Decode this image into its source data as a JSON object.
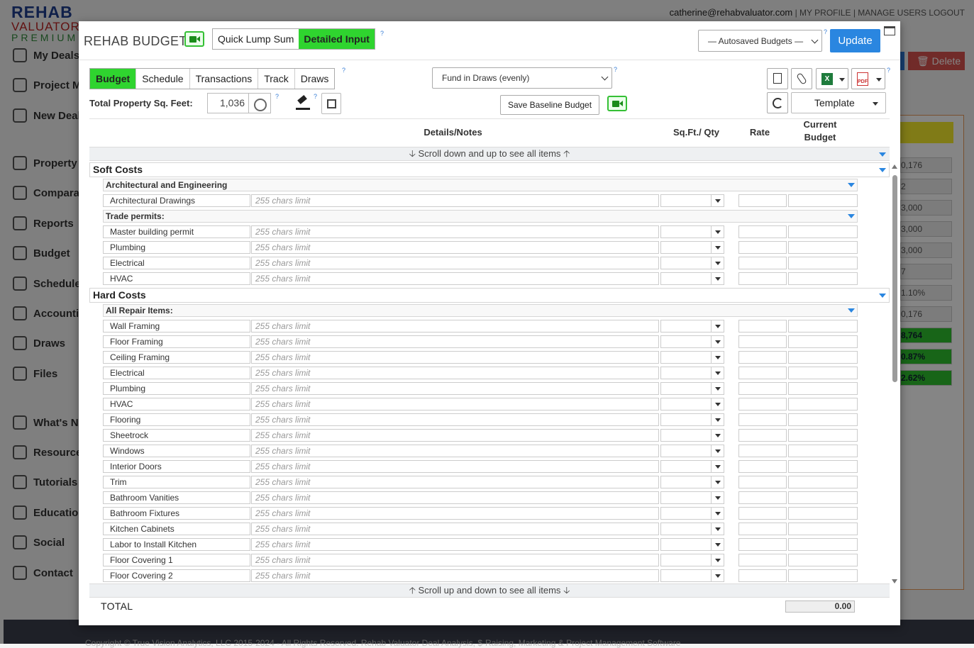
{
  "background": {
    "logo": {
      "line1": "REHAB",
      "line2": "VALUATOR",
      "line3": "PREMIUM"
    },
    "topbar": {
      "email": "catherine@rehabvaluator.com",
      "links": "| MY PROFILE | MANAGE USERS LOGOUT"
    },
    "sidebar": [
      {
        "label": "My Deals",
        "icon": "stack-icon"
      },
      {
        "label": "Project M",
        "icon": "project-icon"
      },
      {
        "label": "New Deal",
        "icon": "new-deal-icon"
      },
      {
        "label": "Property",
        "icon": "property-icon"
      },
      {
        "label": "Compara",
        "icon": "comparables-icon"
      },
      {
        "label": "Reports",
        "icon": "reports-icon"
      },
      {
        "label": "Budget",
        "icon": "budget-icon"
      },
      {
        "label": "Schedule",
        "icon": "schedule-icon"
      },
      {
        "label": "Accounti",
        "icon": "accounting-icon"
      },
      {
        "label": "Draws",
        "icon": "draws-icon"
      },
      {
        "label": "Files",
        "icon": "files-icon"
      },
      {
        "label": "What's N",
        "icon": "megaphone-icon"
      },
      {
        "label": "Resource",
        "icon": "resources-icon"
      },
      {
        "label": "Tutorials",
        "icon": "tutorials-icon"
      },
      {
        "label": "Educatio",
        "icon": "education-icon"
      },
      {
        "label": "Social",
        "icon": "social-icon"
      },
      {
        "label": "Contact",
        "icon": "contact-icon"
      }
    ],
    "delete_label": "Delete",
    "right_values": [
      "0,176",
      "2",
      "3,000",
      "3,000",
      "3,000",
      "7",
      "1.10%",
      "0,176",
      "8,764",
      "0.87%",
      "2.62%"
    ],
    "footer": "Copyright © True Vision Analytics, LLC 2015-2024 - All Rights Reserved. Rehab Valuator Deal Analysis, $-Raising, Marketing & Project Management Software"
  },
  "modal": {
    "title": "REHAB BUDGET",
    "modes": [
      {
        "label": "Quick Lump Sum",
        "active": false
      },
      {
        "label": "Detailed Input",
        "active": true
      }
    ],
    "help_mark": "?",
    "autosaved_select": "— Autosaved Budgets —",
    "update_label": "Update",
    "tabs": [
      {
        "label": "Budget",
        "active": true
      },
      {
        "label": "Schedule",
        "active": false
      },
      {
        "label": "Transactions",
        "active": false
      },
      {
        "label": "Track",
        "active": false
      },
      {
        "label": "Draws",
        "active": false
      }
    ],
    "fund_select": "Fund in Draws (evenly)",
    "sqft_label": "Total Property Sq. Feet:",
    "sqft_value": "1,036",
    "save_baseline_label": "Save Baseline Budget",
    "template_label": "Template",
    "columns": {
      "details": "Details/Notes",
      "qty": "Sq.Ft./ Qty",
      "rate": "Rate",
      "budget_l1": "Current",
      "budget_l2": "Budget"
    },
    "scroll_top": "Scroll down and up to see all items",
    "scroll_bottom": "Scroll up and down to see all items",
    "notes_placeholder": "255 chars limit",
    "sections": [
      {
        "label": "Soft Costs",
        "groups": [
          {
            "label": "Architectural and Engineering",
            "items": [
              "Architectural Drawings"
            ]
          },
          {
            "label": "Trade permits:",
            "items": [
              "Master building permit",
              "Plumbing",
              "Electrical",
              "HVAC"
            ]
          }
        ]
      },
      {
        "label": "Hard Costs",
        "groups": [
          {
            "label": "All Repair Items:",
            "items": [
              "Wall Framing",
              "Floor Framing",
              "Ceiling Framing",
              "Electrical",
              "Plumbing",
              "HVAC",
              "Flooring",
              "Sheetrock",
              "Windows",
              "Interior Doors",
              "Trim",
              "Bathroom Vanities",
              "Bathroom Fixtures",
              "Kitchen Cabinets",
              "Labor to Install Kitchen",
              "Floor Covering 1",
              "Floor Covering 2"
            ]
          }
        ]
      }
    ],
    "total_label": "TOTAL",
    "total_value": "0.00"
  }
}
